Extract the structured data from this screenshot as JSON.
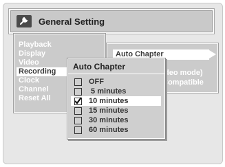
{
  "header": {
    "title": "General Setting",
    "icon": "wrench-icon"
  },
  "menu": {
    "items": [
      "Playback",
      "Display",
      "Video",
      "Recording",
      "Clock",
      "Channel",
      "Reset All"
    ],
    "active_index": 3
  },
  "right_panel": {
    "selected_label": "Auto Chapter",
    "partial_line_1": "ideo mode)",
    "partial_line_2": "Compatible"
  },
  "popup": {
    "title": "Auto Chapter",
    "options": [
      {
        "label": "OFF",
        "checked": false
      },
      {
        "label": " 5 minutes",
        "checked": false
      },
      {
        "label": "10 minutes",
        "checked": true
      },
      {
        "label": "15 minutes",
        "checked": false
      },
      {
        "label": "30 minutes",
        "checked": false
      },
      {
        "label": "60 minutes",
        "checked": false
      }
    ],
    "selected_index": 2
  },
  "colors": {
    "panel": "#cbcbcb",
    "highlight": "#ffffff",
    "text_dark": "#333333"
  }
}
